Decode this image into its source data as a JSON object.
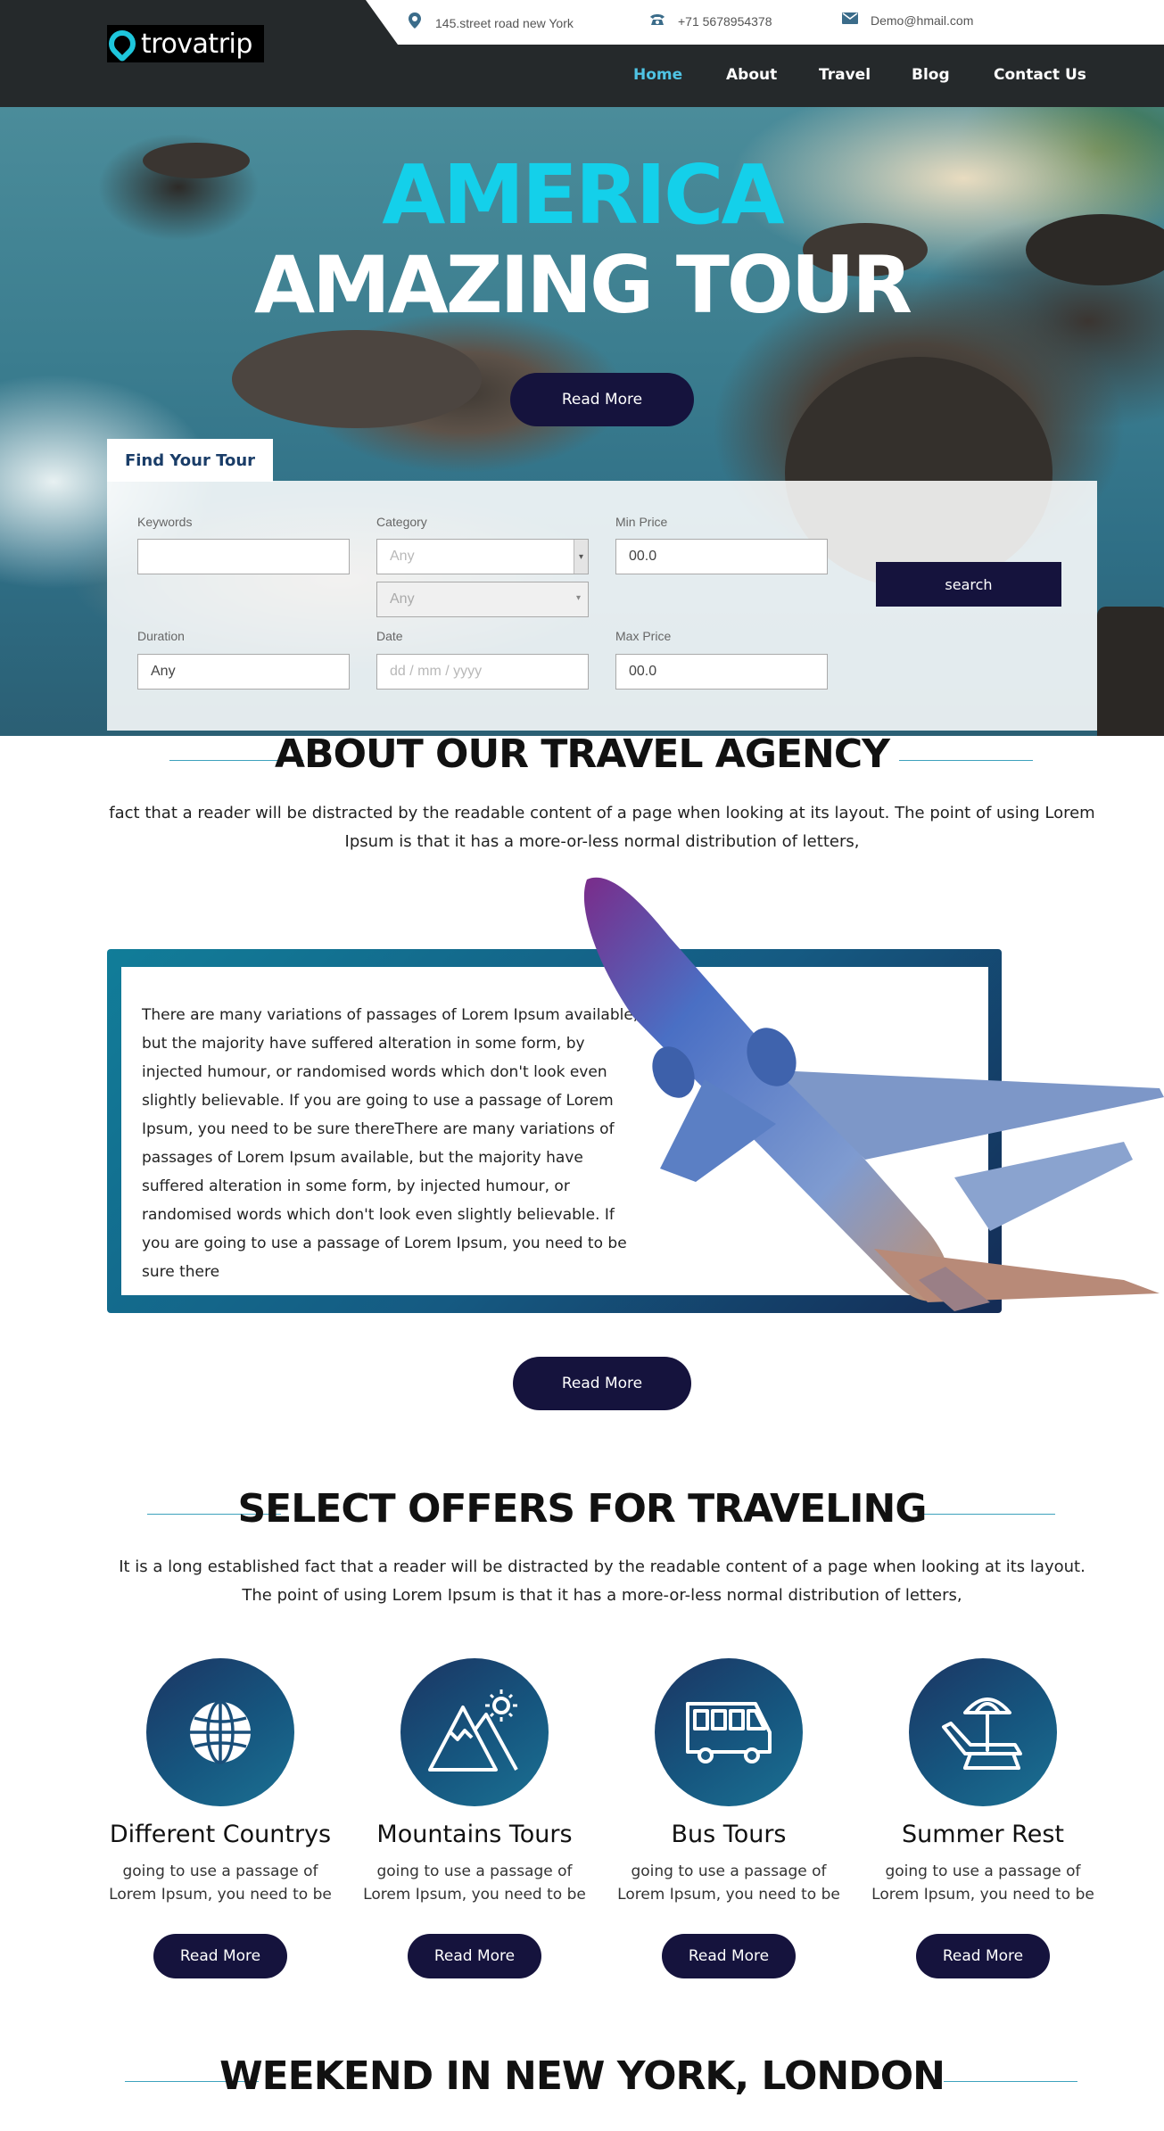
{
  "brand": {
    "name": "trovatrip"
  },
  "topbar": {
    "address": "145.street road new York",
    "phone": "+71 5678954378",
    "email": "Demo@hmail.com"
  },
  "nav": {
    "items": [
      {
        "label": "Home",
        "active": true
      },
      {
        "label": "About"
      },
      {
        "label": "Travel"
      },
      {
        "label": "Blog"
      },
      {
        "label": "Contact Us"
      }
    ]
  },
  "hero": {
    "title_line1": "AMERICA",
    "title_line2": "AMAZING TOUR",
    "button": "Read More"
  },
  "search": {
    "tab": "Find Your Tour",
    "keywords_label": "Keywords",
    "keywords_value": "",
    "category_label": "Category",
    "category_value": "Any",
    "subcategory_value": "Any",
    "min_price_label": "Min Price",
    "min_price_value": "00.0",
    "duration_label": "Duration",
    "duration_value": "Any",
    "date_label": "Date",
    "date_placeholder": "dd / mm / yyyy",
    "max_price_label": "Max Price",
    "max_price_value": "00.0",
    "button": "search"
  },
  "about": {
    "heading": "ABOUT OUR TRAVEL AGENCY",
    "intro": "fact that a reader will be distracted by the readable content of a page when looking at its layout. The point of using Lorem Ipsum is that it has a more-or-less normal distribution of letters,",
    "body": "There are many variations of passages of Lorem Ipsum available, but the majority have suffered alteration in some form, by injected humour, or randomised words which don't look even slightly believable. If you are going to use a passage of Lorem Ipsum, you need to be sure thereThere are many variations of passages of Lorem Ipsum available, but the majority have suffered alteration in some form, by injected humour, or randomised words which don't look even slightly believable. If you are going to use a passage of Lorem Ipsum, you need to be sure there",
    "button": "Read More"
  },
  "offers": {
    "heading": "SELECT OFFERS FOR TRAVELING",
    "intro": "It is a long established fact that a reader will be distracted by the readable content of a page when looking at its layout. The point of using Lorem Ipsum is that it has a more-or-less normal distribution of letters,",
    "cards": [
      {
        "icon": "globe-icon",
        "title": "Different Countrys",
        "text": "going to use a passage of Lorem Ipsum, you need to be",
        "button": "Read More"
      },
      {
        "icon": "mountain-icon",
        "title": "Mountains Tours",
        "text": "going to use a passage of Lorem Ipsum, you need to be",
        "button": "Read More"
      },
      {
        "icon": "bus-icon",
        "title": "Bus Tours",
        "text": "going to use a passage of Lorem Ipsum, you need to be",
        "button": "Read More"
      },
      {
        "icon": "beach-chair-icon",
        "title": "Summer Rest",
        "text": "going to use a passage of Lorem Ipsum, you need to be",
        "button": "Read More"
      }
    ]
  },
  "weekend": {
    "heading": "WEEKEND IN NEW YORK, LONDON"
  },
  "colors": {
    "accent": "#14d0ea",
    "button": "#15133d",
    "header": "#25292b",
    "rule": "#3da2bd"
  }
}
